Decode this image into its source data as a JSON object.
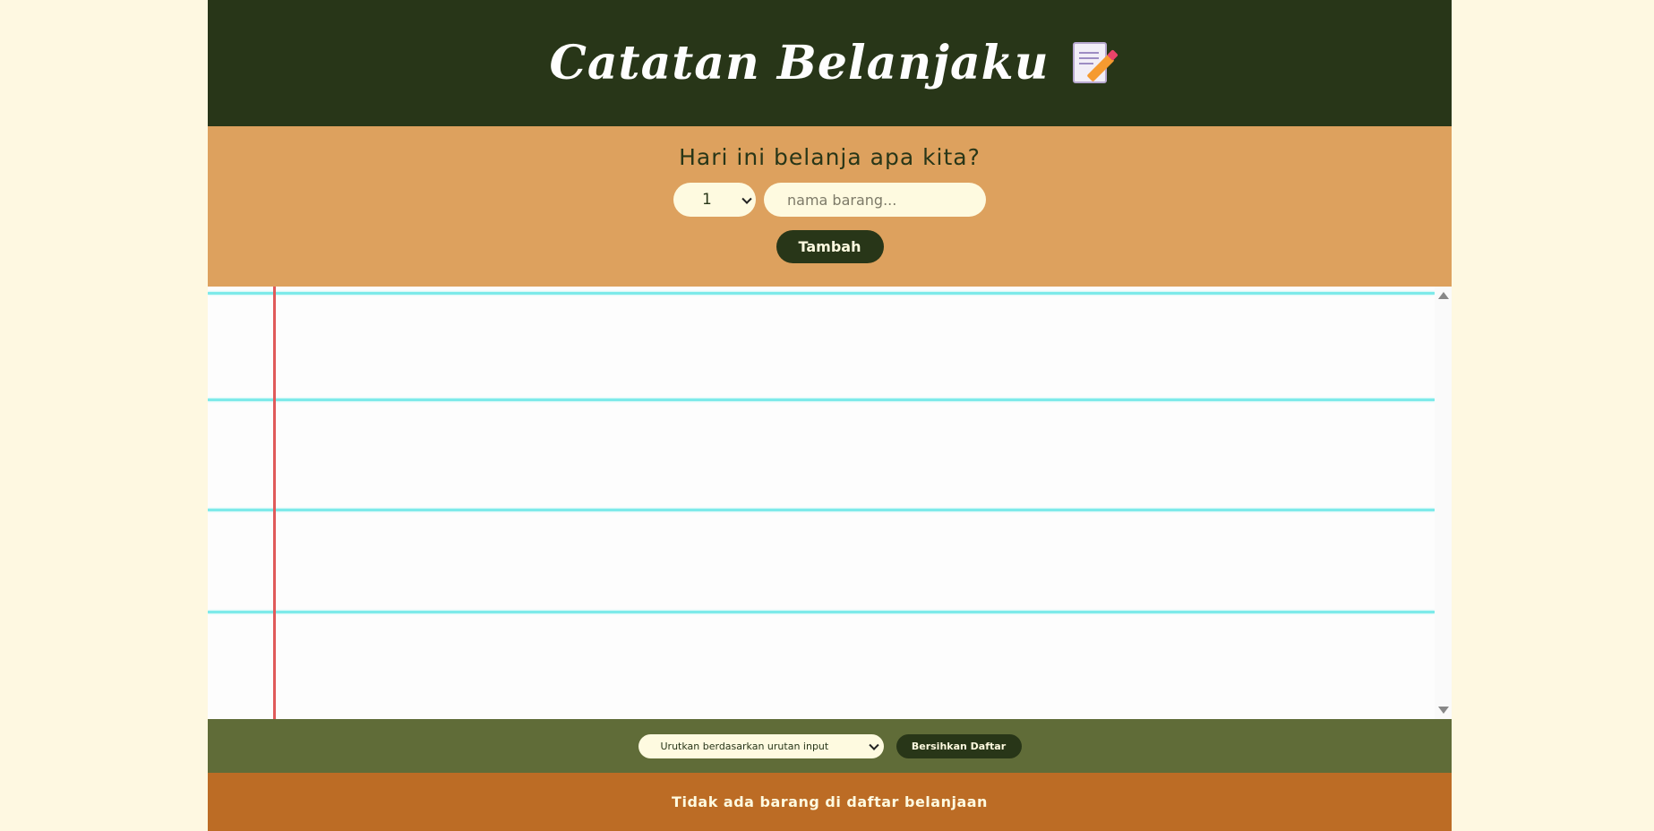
{
  "header": {
    "title": "Catatan Belanjaku",
    "icon": "memo-icon"
  },
  "form": {
    "question": "Hari ini belanja apa kita?",
    "quantity_selected": "1",
    "item_placeholder": "nama barang...",
    "item_value": "",
    "add_label": "Tambah"
  },
  "list": {
    "items": []
  },
  "actions": {
    "sort_selected": "Urutkan berdasarkan urutan input",
    "clear_label": "Bersihkan Daftar"
  },
  "stats": {
    "text": "Tidak ada barang di daftar belanjaan"
  },
  "colors": {
    "page_bg": "#fef8e1",
    "header_bg": "#283618",
    "form_bg": "#dda15e",
    "actions_bg": "#606c38",
    "stats_bg": "#bc6c25",
    "ruled_line": "#7eeaea",
    "margin_line": "#e05a5a"
  }
}
